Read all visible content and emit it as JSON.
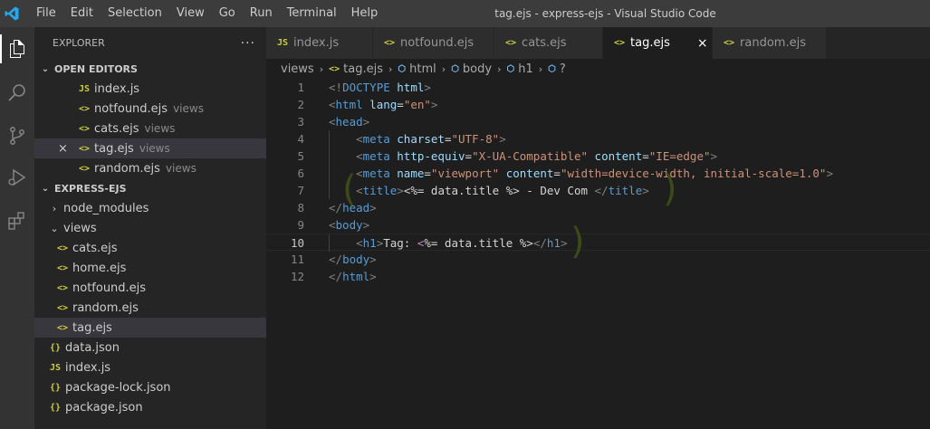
{
  "window": {
    "title": "tag.ejs - express-ejs - Visual Studio Code"
  },
  "menu": [
    "File",
    "Edit",
    "Selection",
    "View",
    "Go",
    "Run",
    "Terminal",
    "Help"
  ],
  "activity_icons": [
    "explorer-icon",
    "search-icon",
    "source-control-icon",
    "run-debug-icon",
    "extensions-icon"
  ],
  "sidebar": {
    "title": "EXPLORER",
    "more": "···",
    "open_editors": {
      "header": "OPEN EDITORS",
      "items": [
        {
          "icon": "JS",
          "name": "index.js",
          "desc": ""
        },
        {
          "icon": "<>",
          "name": "notfound.ejs",
          "desc": "views"
        },
        {
          "icon": "<>",
          "name": "cats.ejs",
          "desc": "views"
        },
        {
          "icon": "<>",
          "name": "tag.ejs",
          "desc": "views",
          "close": "×"
        },
        {
          "icon": "<>",
          "name": "random.ejs",
          "desc": "views"
        }
      ]
    },
    "project": {
      "header": "EXPRESS-EJS",
      "items": [
        {
          "chev": "›",
          "icon": "",
          "name": "node_modules"
        },
        {
          "chev": "⌄",
          "icon": "",
          "name": "views"
        },
        {
          "icon": "<>",
          "name": "cats.ejs"
        },
        {
          "icon": "<>",
          "name": "home.ejs"
        },
        {
          "icon": "<>",
          "name": "notfound.ejs"
        },
        {
          "icon": "<>",
          "name": "random.ejs"
        },
        {
          "icon": "<>",
          "name": "tag.ejs"
        },
        {
          "icon": "{}",
          "name": "data.json"
        },
        {
          "icon": "JS",
          "name": "index.js"
        },
        {
          "icon": "{}",
          "name": "package-lock.json"
        },
        {
          "icon": "{}",
          "name": "package.json"
        }
      ]
    }
  },
  "tabs": [
    {
      "icon": "JS",
      "label": "index.js"
    },
    {
      "icon": "<>",
      "label": "notfound.ejs"
    },
    {
      "icon": "<>",
      "label": "cats.ejs"
    },
    {
      "icon": "<>",
      "label": "tag.ejs",
      "close": "×"
    },
    {
      "icon": "<>",
      "label": "random.ejs"
    }
  ],
  "breadcrumb": {
    "folder": "views",
    "file": "tag.ejs",
    "html": "html",
    "body": "body",
    "h1": "h1",
    "last": "?"
  },
  "editor": {
    "line_numbers": [
      "1",
      "2",
      "3",
      "4",
      "5",
      "6",
      "7",
      "8",
      "9",
      "10",
      "11",
      "12"
    ],
    "current_line": "10"
  },
  "colors": {
    "tag": "#569cd6",
    "attr": "#9cdcfe",
    "string": "#ce9178",
    "bracket": "#808080",
    "icon_yellow": "#cbcb41",
    "vscode_blue": "#23a9f2"
  }
}
